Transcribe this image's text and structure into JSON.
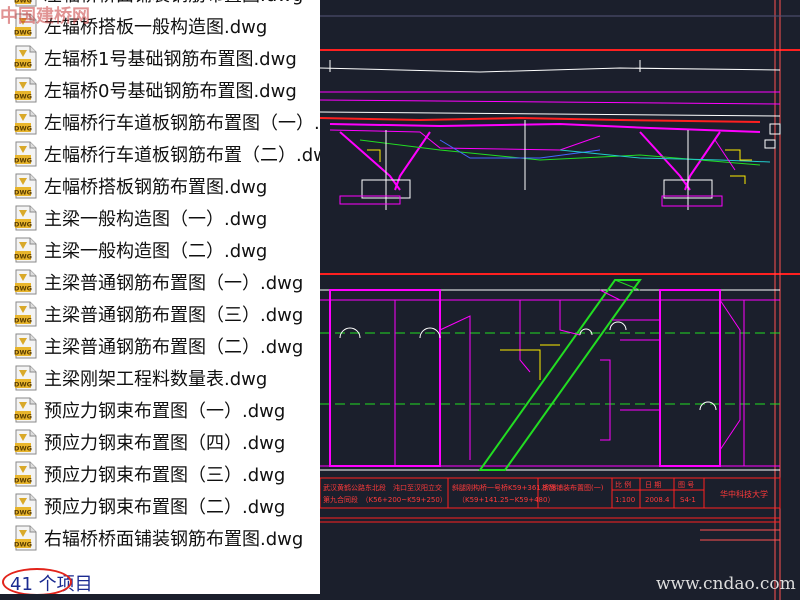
{
  "file_panel": {
    "items": [
      {
        "name": "左辐桥桥面铺装钢筋布置图.dwg",
        "icon": "dwg-file-icon"
      },
      {
        "name": "左辐桥搭板一般构造图.dwg",
        "icon": "dwg-file-icon"
      },
      {
        "name": "左辐桥1号基础钢筋布置图.dwg",
        "icon": "dwg-file-icon"
      },
      {
        "name": "左辐桥0号基础钢筋布置图.dwg",
        "icon": "dwg-file-icon"
      },
      {
        "name": "左幅桥行车道板钢筋布置图（一）.dwg",
        "icon": "dwg-file-icon"
      },
      {
        "name": "左幅桥行车道板钢筋布置（二）.dwg",
        "icon": "dwg-file-icon"
      },
      {
        "name": "左幅桥搭板钢筋布置图.dwg",
        "icon": "dwg-file-icon"
      },
      {
        "name": "主梁一般构造图（一）.dwg",
        "icon": "dwg-file-icon"
      },
      {
        "name": "主梁一般构造图（二）.dwg",
        "icon": "dwg-file-icon"
      },
      {
        "name": "主梁普通钢筋布置图（一）.dwg",
        "icon": "dwg-file-icon"
      },
      {
        "name": "主梁普通钢筋布置图（三）.dwg",
        "icon": "dwg-file-icon"
      },
      {
        "name": "主梁普通钢筋布置图（二）.dwg",
        "icon": "dwg-file-icon"
      },
      {
        "name": "主梁刚架工程料数量表.dwg",
        "icon": "dwg-file-icon"
      },
      {
        "name": "预应力钢束布置图（一）.dwg",
        "icon": "dwg-file-icon"
      },
      {
        "name": "预应力钢束布置图（四）.dwg",
        "icon": "dwg-file-icon"
      },
      {
        "name": "预应力钢束布置图（三）.dwg",
        "icon": "dwg-file-icon"
      },
      {
        "name": "预应力钢束布置图（二）.dwg",
        "icon": "dwg-file-icon"
      },
      {
        "name": "右辐桥桥面铺装钢筋布置图.dwg",
        "icon": "dwg-file-icon"
      }
    ],
    "icon_label": "DWG",
    "item_count": "41 个项目"
  },
  "watermarks": {
    "top": "中国建桥网",
    "bottom": "www.cndao.com"
  },
  "cad_drawing": {
    "title_block": {
      "project": "武汉黄鹤公路东北段　沌口至汉阳立交",
      "project_sub": "第九合同段　（K56+200~K59+250）",
      "sheet_title": "斜腿刚构桥一号桥K59+361.378",
      "sheet_sub": "（K59+141.25~K59+480）",
      "drawing_name": "桥面铺装布置图(一)",
      "col_scale": "比 例",
      "col_date": "日 期",
      "col_number": "图 号",
      "scale_value": "1:100",
      "date_value": "2008.4",
      "number_value": "S4-1",
      "institution": "华中科技大学"
    },
    "colors": {
      "background": "#1b1f2c",
      "magenta": "#ff00ff",
      "white": "#ffffff",
      "red": "#ff2020",
      "green": "#22dd22",
      "yellow": "#ffee00",
      "cyan": "#22cccc",
      "blue": "#4466ff",
      "titleblock_text": "#ff3a3a",
      "titleblock_border": "#ff2020"
    }
  }
}
